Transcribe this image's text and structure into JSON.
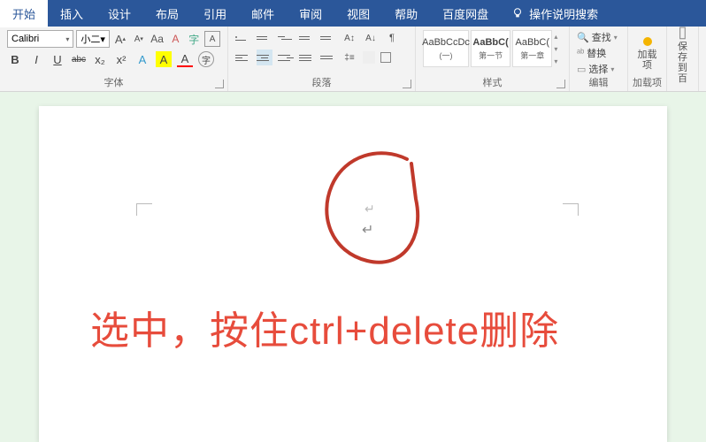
{
  "menu": {
    "tabs": [
      "开始",
      "插入",
      "设计",
      "布局",
      "引用",
      "邮件",
      "审阅",
      "视图",
      "帮助",
      "百度网盘"
    ],
    "active_index": 0,
    "help_search": "操作说明搜索"
  },
  "font": {
    "name": "Calibri",
    "size": "小二",
    "increase": "A",
    "decrease": "A",
    "case": "Aa",
    "clear": "A",
    "bold": "B",
    "italic": "I",
    "underline": "U",
    "strike": "abc",
    "sub": "x₂",
    "sup": "x²",
    "effects": "A",
    "highlight": "A",
    "color": "A",
    "phonetic": "字",
    "border": "A",
    "group_label": "字体"
  },
  "para": {
    "group_label": "段落"
  },
  "styles": {
    "s1_preview": "AaBbCcDc",
    "s1_name": "(一)",
    "s2_preview": "AaBbC(",
    "s2_name": "第一节",
    "s3_preview": "AaBbC(",
    "s3_name": "第一章",
    "group_label": "样式"
  },
  "edit": {
    "find": "查找",
    "replace": "替换",
    "select": "选择",
    "group_label": "编辑"
  },
  "addin": {
    "label": "加载项",
    "group_label": "加载项"
  },
  "extra": {
    "label": "保存到百"
  },
  "doc": {
    "annotation": "选中，按住ctrl+delete删除"
  }
}
